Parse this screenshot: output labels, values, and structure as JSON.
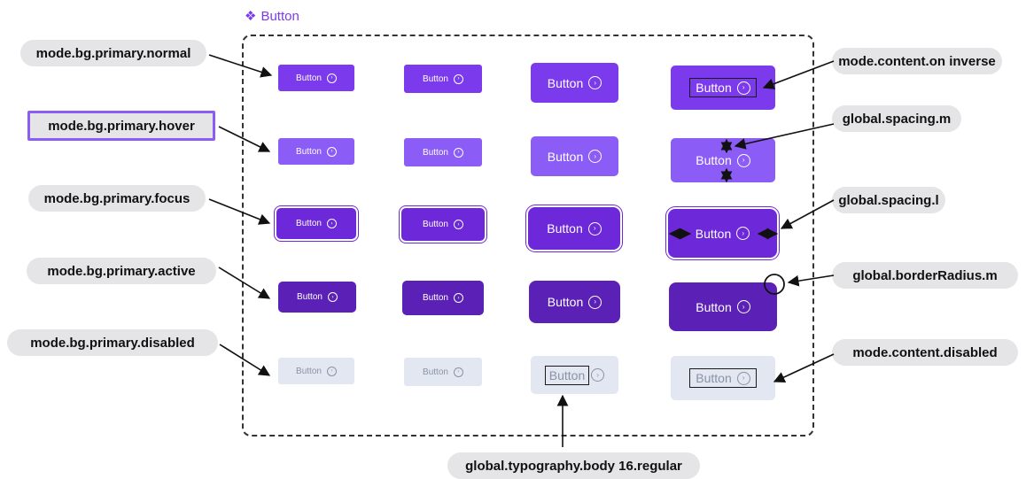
{
  "component": {
    "icon": "component-diamond-icon",
    "title": "Button"
  },
  "button_label": "Button",
  "button_icon": "chevron-right-circle-icon",
  "colors": {
    "normal": "#7c3aed",
    "hover": "#8b5cf6",
    "focus": "#6d28d9",
    "active": "#5b21b6",
    "disabled_bg": "#e3e7f1",
    "disabled_text": "#8a93a6",
    "tag_bg": "#e5e5e7",
    "highlight": "#8b5cf6"
  },
  "states": [
    {
      "key": "normal",
      "label": "mode.bg.primary.normal"
    },
    {
      "key": "hover",
      "label": "mode.bg.primary.hover"
    },
    {
      "key": "focus",
      "label": "mode.bg.primary.focus"
    },
    {
      "key": "active",
      "label": "mode.bg.primary.active"
    },
    {
      "key": "disabled",
      "label": "mode.bg.primary.disabled"
    }
  ],
  "tokens": {
    "content_on_inverse": "mode.content.on inverse",
    "spacing_m": "global.spacing.m",
    "spacing_l": "global.spacing.l",
    "border_radius_m": "global.borderRadius.m",
    "content_disabled": "mode.content.disabled",
    "typography": "global.typography.body 16.regular"
  }
}
